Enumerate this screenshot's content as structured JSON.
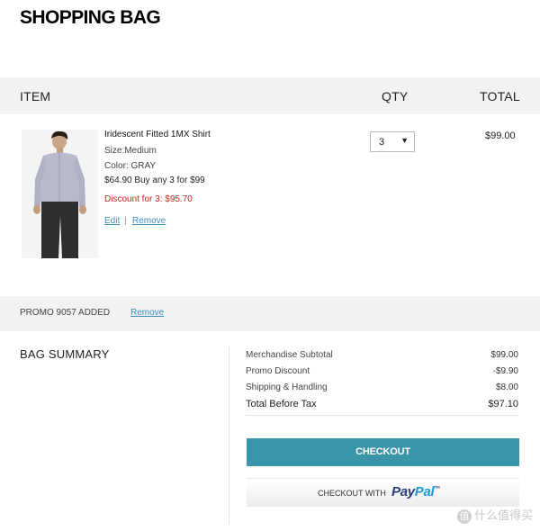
{
  "page": {
    "title": "SHOPPING BAG"
  },
  "table_header": {
    "item": "ITEM",
    "qty": "QTY",
    "total": "TOTAL"
  },
  "item": {
    "name": "Iridescent Fitted 1MX Shirt",
    "size": "Size:Medium",
    "color": "Color: GRAY",
    "price_offer": "$64.90 Buy any 3 for $99",
    "discount": "Discount for 3: $95.70",
    "edit_link": "Edit",
    "separator": "|",
    "remove_link": "Remove",
    "quantity": "3",
    "line_total": "$99.00",
    "image_icon": "product-photo-shirt"
  },
  "promo": {
    "text": "PROMO 9057 ADDED",
    "remove_link": "Remove"
  },
  "summary": {
    "title": "BAG SUMMARY",
    "rows": [
      {
        "label": "Merchandise Subtotal",
        "value": "$99.00"
      },
      {
        "label": "Promo Discount",
        "value": "-$9.90"
      },
      {
        "label": "Shipping & Handling",
        "value": "$8.00"
      }
    ],
    "total_label": "Total Before Tax",
    "total_value": "$97.10"
  },
  "buttons": {
    "checkout": "CHECKOUT",
    "paypal_prefix": "CHECKOUT WITH",
    "paypal_pay": "Pay",
    "paypal_pal": "Pal",
    "paypal_tm": "™"
  },
  "watermark": {
    "badge": "值",
    "text": "什么值得买"
  },
  "colors": {
    "checkout_button": "#3a95a8",
    "discount_red": "#c0261e",
    "link_blue": "#3f8ebf",
    "band_gray": "#f2f2f2",
    "paypal_dark": "#253b80",
    "paypal_light": "#179bd7"
  }
}
